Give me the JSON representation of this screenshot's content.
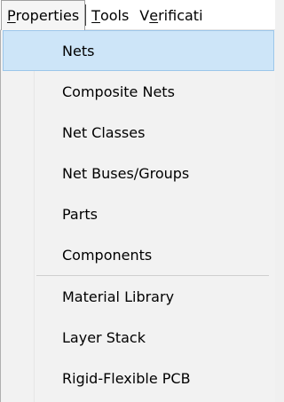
{
  "menubar": {
    "items": [
      {
        "label_ul": "P",
        "label_rest": "roperties"
      },
      {
        "label_ul": "T",
        "label_rest": "ools"
      },
      {
        "label_pre": "V",
        "label_ul": "e",
        "label_rest": "rificati"
      }
    ]
  },
  "dropdown": {
    "group1": [
      "Nets",
      "Composite Nets",
      "Net Classes",
      "Net Buses/Groups",
      "Parts",
      "Components"
    ],
    "group2": [
      "Material Library",
      "Layer Stack",
      "Rigid-Flexible PCB"
    ],
    "highlighted": "Nets"
  },
  "colors": {
    "highlight": "#cde5f8",
    "highlight_border": "#9cc6ea",
    "menu_bg": "#f2f2f2"
  }
}
